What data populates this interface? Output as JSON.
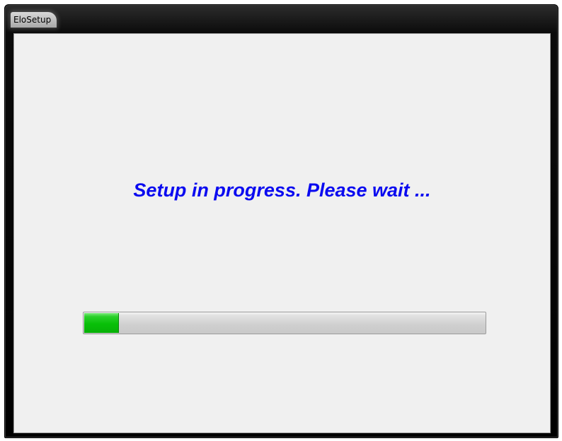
{
  "window": {
    "title": "EloSetup"
  },
  "main": {
    "status_message": "Setup in progress. Please wait ..."
  },
  "progress": {
    "value_fraction": 0.085
  },
  "colors": {
    "message_text": "#0a0af0",
    "progress_fill": "#08c008",
    "client_background": "#f0f0f0"
  }
}
